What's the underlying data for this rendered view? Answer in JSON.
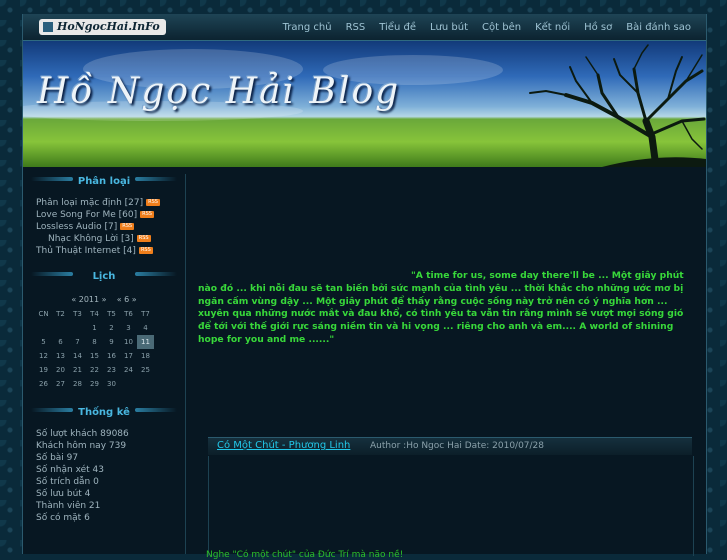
{
  "header": {
    "logo": "HoNgocHai.InFo",
    "nav": [
      "Trang chủ",
      "RSS",
      "Tiểu đề",
      "Lưu bút",
      "Cột bên",
      "Kết nối",
      "Hồ sơ",
      "Bài đánh sao"
    ]
  },
  "banner": {
    "title": "Hồ Ngọc Hải Blog"
  },
  "sidebar": {
    "categories_title": "Phân loại",
    "categories": [
      {
        "label": "Phân loại mặc định [27]",
        "rss": "RSS"
      },
      {
        "label": "Love Song For Me [60]",
        "rss": "RSS"
      },
      {
        "label": "Lossless Audio [7]",
        "rss": "RSS"
      },
      {
        "label": "Nhạc Không Lời [3]",
        "rss": "RSS"
      },
      {
        "label": "Thủ Thuật Internet [4]",
        "rss": "RSS"
      }
    ],
    "calendar_title": "Lịch",
    "calendar": {
      "year_nav": "« 2011 »",
      "month_nav": "« 6 »",
      "weekdays": [
        "CN",
        "T2",
        "T3",
        "T4",
        "T5",
        "T6",
        "T7"
      ],
      "weeks": [
        [
          "",
          "",
          "",
          "1",
          "2",
          "3",
          "4"
        ],
        [
          "5",
          "6",
          "7",
          "8",
          "9",
          "10",
          "11"
        ],
        [
          "12",
          "13",
          "14",
          "15",
          "16",
          "17",
          "18"
        ],
        [
          "19",
          "20",
          "21",
          "22",
          "23",
          "24",
          "25"
        ],
        [
          "26",
          "27",
          "28",
          "29",
          "30",
          "",
          ""
        ]
      ],
      "today": "11"
    },
    "stats_title": "Thống kê",
    "stats": [
      "Số lượt khách 89086",
      "Khách hôm nay 739",
      "Số bài 97",
      "Số nhận xét 43",
      "Số trích dẫn 0",
      "Số lưu bút 4",
      "Thành viên 21",
      "Số có mặt 6"
    ]
  },
  "main": {
    "quote_first": "\"A time for us, some day there'll be ... Một giây phút",
    "quote_rest": "nào đó ... khi nỗi đau sẽ tan biến bởi sức mạnh của tình yêu ... thời khắc cho những ước mơ bị ngăn cấm vùng dậy ... Một giây phút để thấy rằng cuộc sống này trở nên có ý nghĩa hơn ... xuyên qua những nước mắt và đau khổ, có tình yêu ta vẫn tin rằng mình sẽ vượt mọi sóng gió để tới với thế giới rực sáng niềm tin và hi vọng ... riêng cho anh và em.... A world of shining hope for you and me ......\"",
    "post": {
      "title": "Có Một Chút - Phương Linh",
      "meta": "Author :Ho Ngoc Hai Date: 2010/07/28",
      "excerpt": "Nghe \"Có một chút\" của Đức Trí mà não nề!"
    }
  }
}
